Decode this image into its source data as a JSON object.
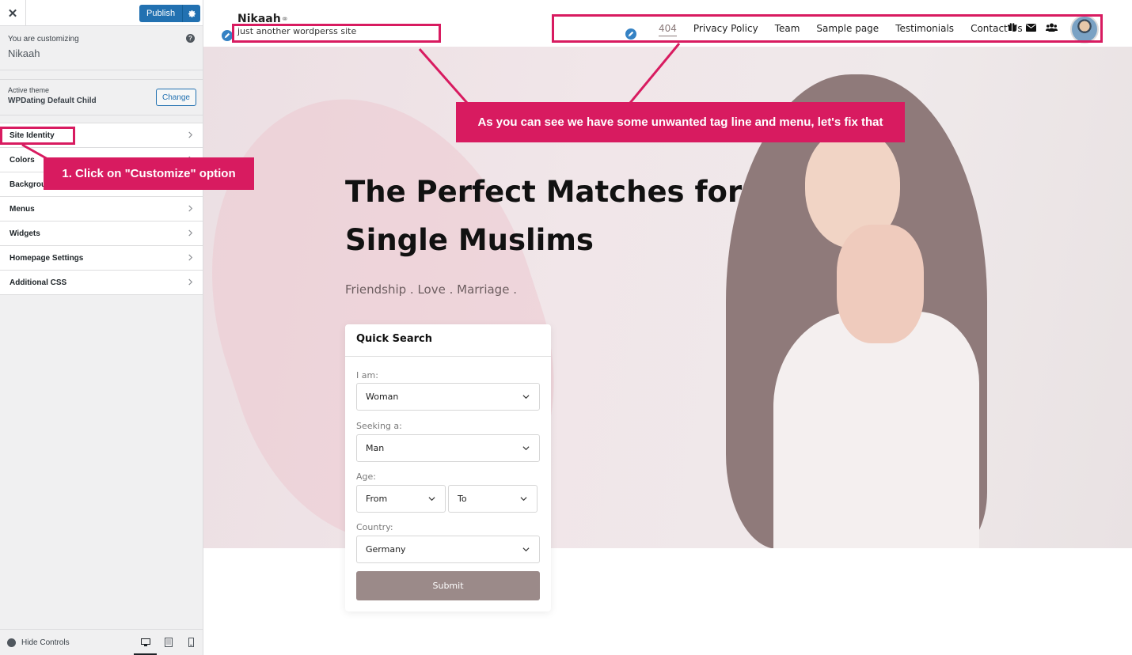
{
  "sidebar": {
    "close_glyph": "✕",
    "publish_label": "Publish",
    "customizing_label": "You are customizing",
    "site_name": "Nikaah",
    "help_glyph": "?",
    "active_theme_label": "Active theme",
    "theme_name": "WPDating Default Child",
    "change_label": "Change",
    "sections": [
      "Site Identity",
      "Colors",
      "Background Image",
      "Menus",
      "Widgets",
      "Homepage Settings",
      "Additional CSS"
    ],
    "hide_controls_label": "Hide Controls"
  },
  "preview": {
    "brand": "Nikaah",
    "brand_glyph": "⚭",
    "tagline": "just another wordperss site",
    "nav": [
      "404",
      "Privacy Policy",
      "Team",
      "Sample page",
      "Testimonials",
      "Contact Us"
    ],
    "nav_icons": [
      "gift-icon",
      "envelope-icon",
      "users-icon"
    ],
    "hero_title_line1": "The Perfect Matches for",
    "hero_title_line2": "Single Muslims",
    "hero_subtitle": "Friendship . Love . Marriage .",
    "quick_search": {
      "title": "Quick Search",
      "i_am_label": "I am:",
      "i_am_value": "Woman",
      "seeking_label": "Seeking a:",
      "seeking_value": "Man",
      "age_label": "Age:",
      "age_from": "From",
      "age_to": "To",
      "country_label": "Country:",
      "country_value": "Germany",
      "submit_label": "Submit"
    }
  },
  "annotations": {
    "step_callout": "1. Click on \"Customize\" option",
    "menu_callout": "As you can see we have some unwanted tag line and menu, let's fix that"
  },
  "colors": {
    "accent": "#d81b60",
    "wp_blue": "#2271b1",
    "submit": "#9b8a89"
  }
}
